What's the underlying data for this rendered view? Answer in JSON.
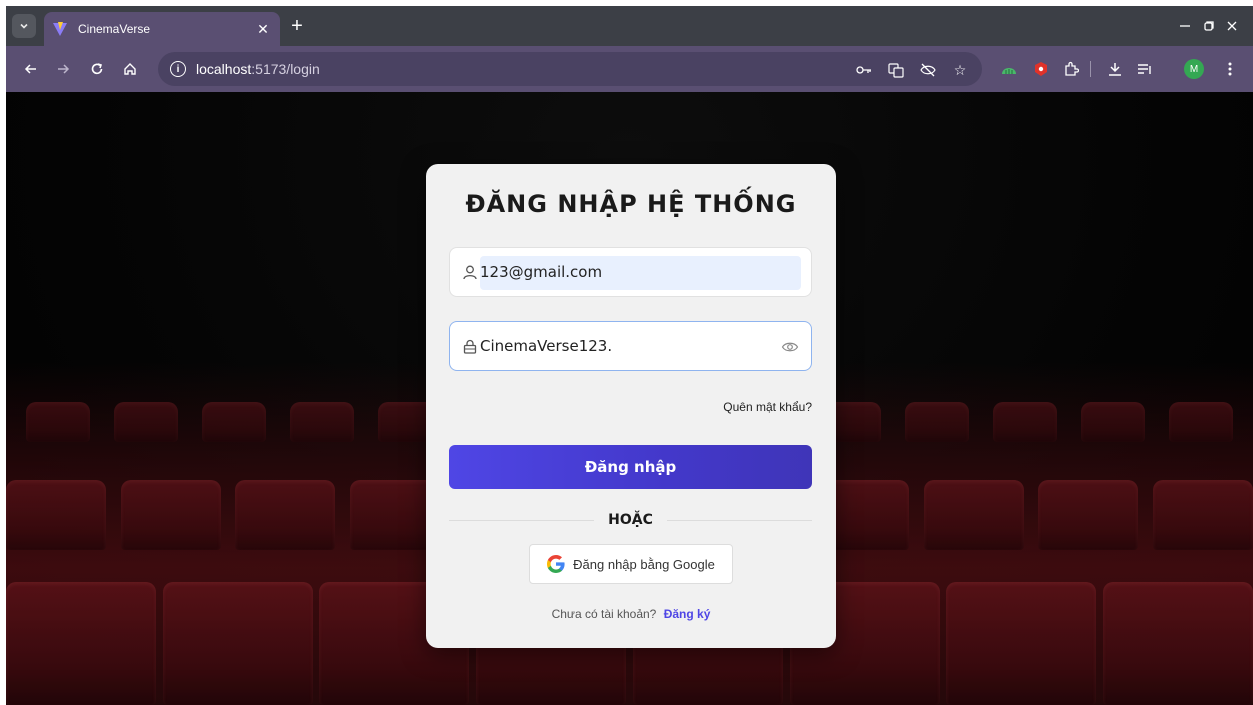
{
  "browser": {
    "tab_title": "CinemaVerse",
    "url_host": "localhost",
    "url_path": ":5173/login",
    "profile_initial": "M",
    "colors": {
      "frame": "#5a4f72",
      "accent": "#4f46e5"
    }
  },
  "login": {
    "title": "ĐĂNG NHẬP HỆ THỐNG",
    "email_value": "123@gmail.com",
    "password_value": "CinemaVerse123.",
    "forgot_label": "Quên mật khẩu?",
    "submit_label": "Đăng nhập",
    "divider_label": "HOẶC",
    "google_label": "Đăng nhập bằng Google",
    "signup_prompt": "Chưa có tài khoản?",
    "signup_link": "Đăng ký"
  }
}
